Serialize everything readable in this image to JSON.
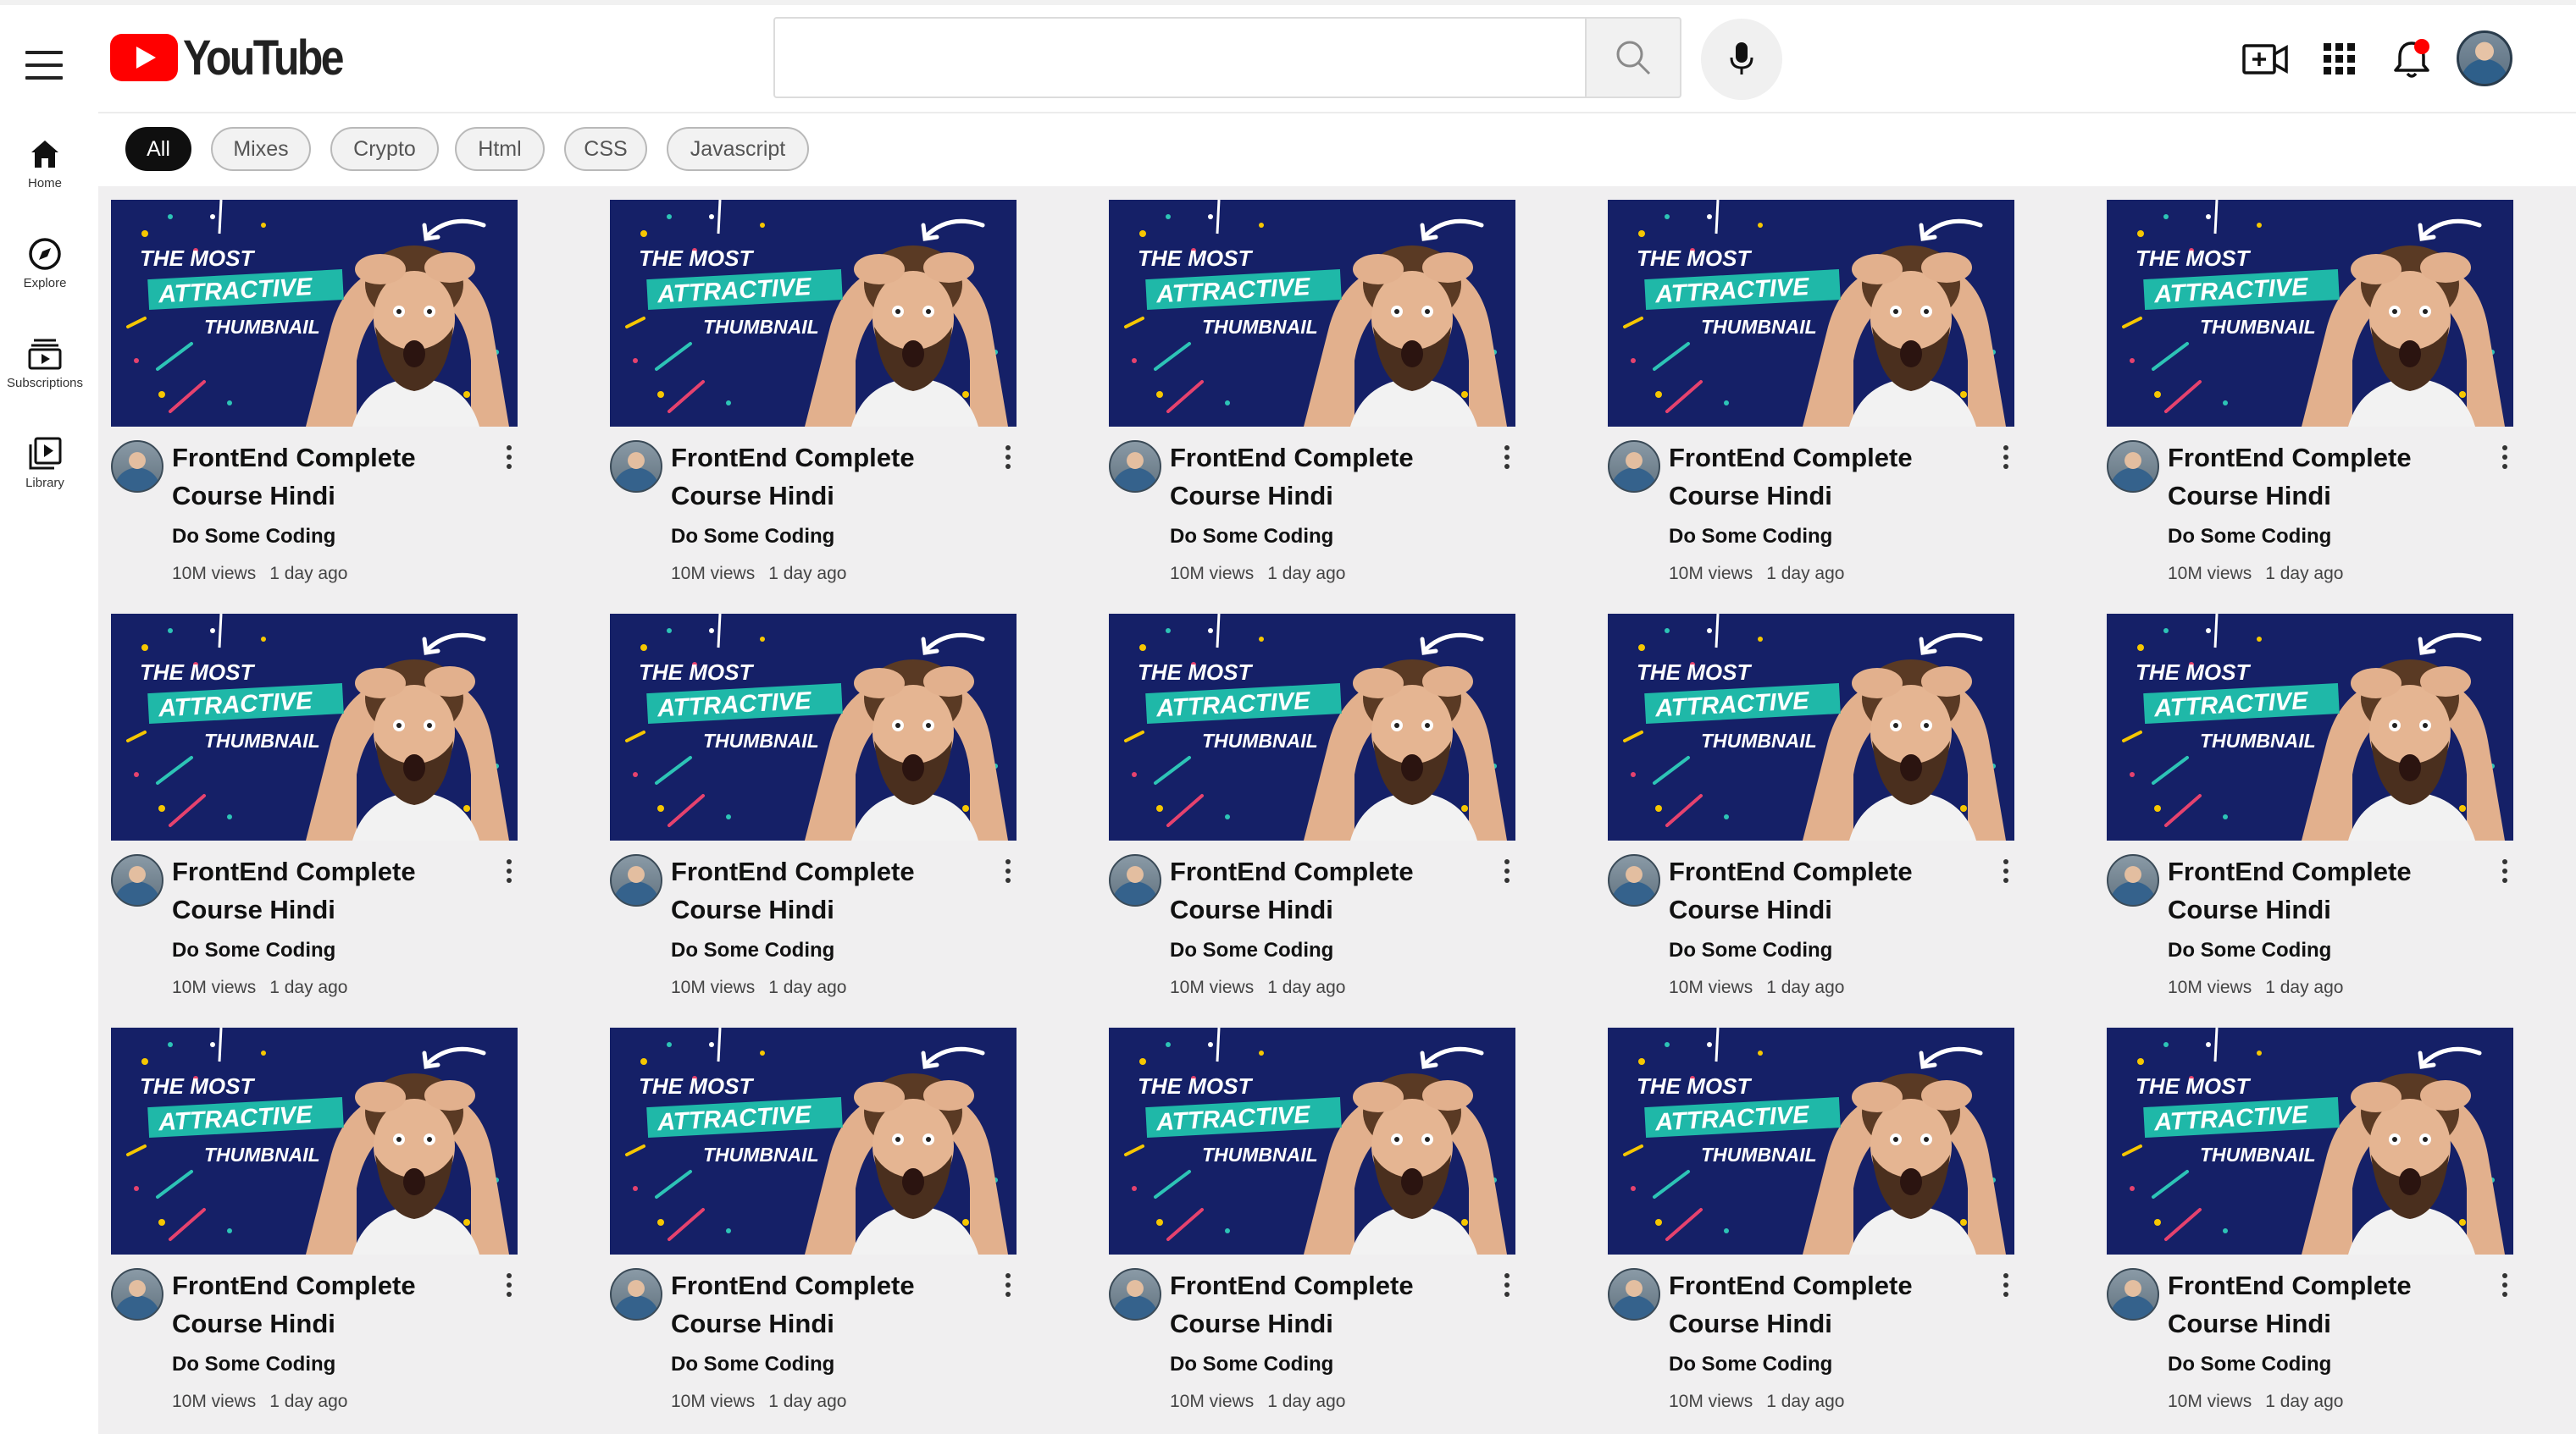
{
  "header": {
    "logo_text": "YouTube",
    "search_placeholder": "",
    "search_value": "",
    "icons": {
      "menu": "hamburger-menu-icon",
      "search": "search-icon",
      "mic": "mic-icon",
      "create": "create-video-icon",
      "apps": "apps-grid-icon",
      "notifications": "bell-icon",
      "account": "avatar"
    },
    "notification_dot_color": "#ff0000"
  },
  "sidebar": {
    "items": [
      {
        "label": "Home",
        "icon": "home-icon"
      },
      {
        "label": "Explore",
        "icon": "compass-icon"
      },
      {
        "label": "Subscriptions",
        "icon": "subscriptions-icon"
      },
      {
        "label": "Library",
        "icon": "library-icon"
      }
    ]
  },
  "chips": [
    {
      "label": "All",
      "active": true
    },
    {
      "label": "Mixes",
      "active": false
    },
    {
      "label": "Crypto",
      "active": false
    },
    {
      "label": "Html",
      "active": false
    },
    {
      "label": "CSS",
      "active": false
    },
    {
      "label": "Javascript",
      "active": false
    }
  ],
  "thumbnail_text": {
    "line1": "THE MOST",
    "line2": "ATTRACTIVE",
    "line3": "THUMBNAIL"
  },
  "videos": [
    {
      "title_line1": "FrontEnd Complete",
      "title_line2": "Course Hindi",
      "channel": "Do Some Coding",
      "views": "10M views",
      "age": "1 day ago"
    },
    {
      "title_line1": "FrontEnd Complete",
      "title_line2": "Course Hindi",
      "channel": "Do Some Coding",
      "views": "10M views",
      "age": "1 day ago"
    },
    {
      "title_line1": "FrontEnd Complete",
      "title_line2": "Course Hindi",
      "channel": "Do Some Coding",
      "views": "10M views",
      "age": "1 day ago"
    },
    {
      "title_line1": "FrontEnd Complete",
      "title_line2": "Course Hindi",
      "channel": "Do Some Coding",
      "views": "10M views",
      "age": "1 day ago"
    },
    {
      "title_line1": "FrontEnd Complete",
      "title_line2": "Course Hindi",
      "channel": "Do Some Coding",
      "views": "10M views",
      "age": "1 day ago"
    },
    {
      "title_line1": "FrontEnd Complete",
      "title_line2": "Course Hindi",
      "channel": "Do Some Coding",
      "views": "10M views",
      "age": "1 day ago"
    },
    {
      "title_line1": "FrontEnd Complete",
      "title_line2": "Course Hindi",
      "channel": "Do Some Coding",
      "views": "10M views",
      "age": "1 day ago"
    },
    {
      "title_line1": "FrontEnd Complete",
      "title_line2": "Course Hindi",
      "channel": "Do Some Coding",
      "views": "10M views",
      "age": "1 day ago"
    },
    {
      "title_line1": "FrontEnd Complete",
      "title_line2": "Course Hindi",
      "channel": "Do Some Coding",
      "views": "10M views",
      "age": "1 day ago"
    },
    {
      "title_line1": "FrontEnd Complete",
      "title_line2": "Course Hindi",
      "channel": "Do Some Coding",
      "views": "10M views",
      "age": "1 day ago"
    },
    {
      "title_line1": "FrontEnd Complete",
      "title_line2": "Course Hindi",
      "channel": "Do Some Coding",
      "views": "10M views",
      "age": "1 day ago"
    },
    {
      "title_line1": "FrontEnd Complete",
      "title_line2": "Course Hindi",
      "channel": "Do Some Coding",
      "views": "10M views",
      "age": "1 day ago"
    },
    {
      "title_line1": "FrontEnd Complete",
      "title_line2": "Course Hindi",
      "channel": "Do Some Coding",
      "views": "10M views",
      "age": "1 day ago"
    },
    {
      "title_line1": "FrontEnd Complete",
      "title_line2": "Course Hindi",
      "channel": "Do Some Coding",
      "views": "10M views",
      "age": "1 day ago"
    },
    {
      "title_line1": "FrontEnd Complete",
      "title_line2": "Course Hindi",
      "channel": "Do Some Coding",
      "views": "10M views",
      "age": "1 day ago"
    }
  ],
  "colors": {
    "brand_red": "#ff0000",
    "thumbnail_bg": "#152067",
    "thumbnail_banner": "#1fb8a8",
    "content_bg": "#f0eff0"
  }
}
